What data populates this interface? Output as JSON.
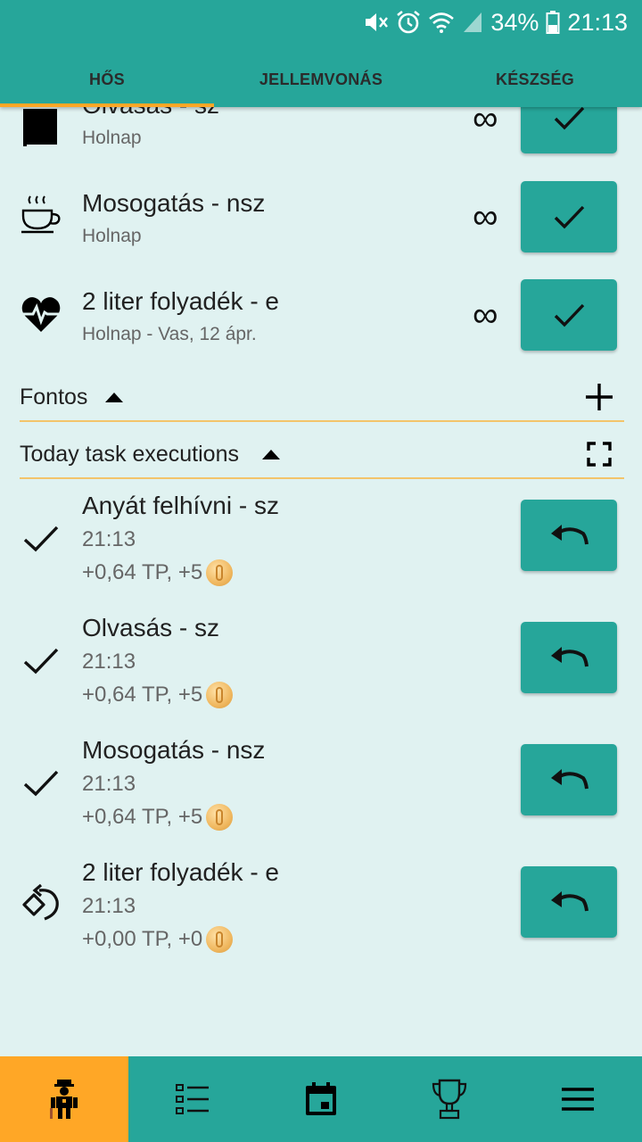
{
  "status": {
    "battery": "34%",
    "time": "21:13"
  },
  "tabs": [
    {
      "label": "HŐS"
    },
    {
      "label": "JELLEMVONÁS"
    },
    {
      "label": "KÉSZSÉG"
    }
  ],
  "tasks": [
    {
      "title": "Olvasás - sz",
      "subtitle": "Holnap",
      "icon": "book-icon",
      "repeat": "∞"
    },
    {
      "title": "Mosogatás - nsz",
      "subtitle": "Holnap",
      "icon": "coffee-cup-icon",
      "repeat": "∞"
    },
    {
      "title": "2 liter folyadék - e",
      "subtitle": "Holnap - Vas, 12 ápr.",
      "icon": "heart-pulse-icon",
      "repeat": "∞"
    }
  ],
  "sections": {
    "important": {
      "title": "Fontos"
    },
    "executions": {
      "title": "Today task executions"
    }
  },
  "executions": [
    {
      "title": "Anyát felhívni - sz",
      "time": "21:13",
      "reward": "+0,64 TP, +5",
      "state_icon": "check-icon"
    },
    {
      "title": "Olvasás - sz",
      "time": "21:13",
      "reward": "+0,64 TP, +5",
      "state_icon": "check-icon"
    },
    {
      "title": "Mosogatás - nsz",
      "time": "21:13",
      "reward": "+0,64 TP, +5",
      "state_icon": "check-icon"
    },
    {
      "title": "2 liter folyadék - e",
      "time": "21:13",
      "reward": "+0,00 TP, +0",
      "state_icon": "rotate-icon"
    }
  ],
  "bottom_nav": [
    {
      "icon": "hero-avatar-icon",
      "active": true
    },
    {
      "icon": "task-list-icon",
      "active": false
    },
    {
      "icon": "calendar-icon",
      "active": false
    },
    {
      "icon": "trophy-icon",
      "active": false
    },
    {
      "icon": "menu-icon",
      "active": false
    }
  ],
  "colors": {
    "primary": "#26a69a",
    "accent": "#ffa726",
    "background": "#e0f2f1",
    "divider": "#f3c46b"
  }
}
